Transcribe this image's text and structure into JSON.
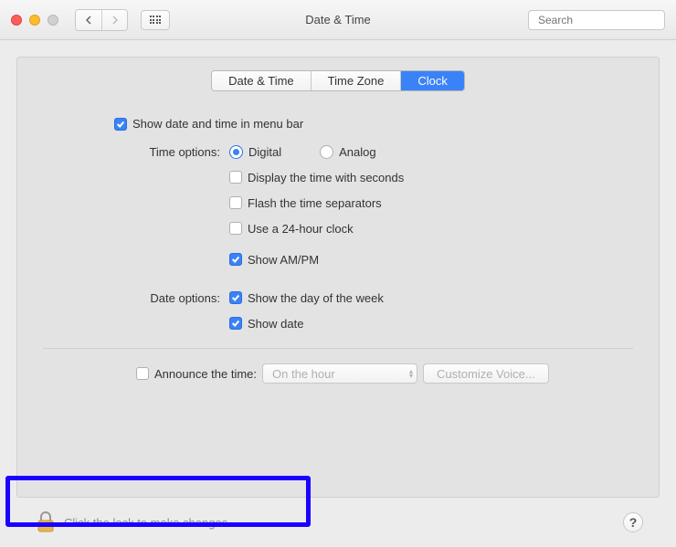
{
  "window": {
    "title": "Date & Time"
  },
  "search": {
    "placeholder": "Search"
  },
  "tabs": {
    "date_time": "Date & Time",
    "time_zone": "Time Zone",
    "clock": "Clock"
  },
  "clock": {
    "show_in_menu_bar": "Show date and time in menu bar",
    "time_options_label": "Time options:",
    "digital": "Digital",
    "analog": "Analog",
    "display_seconds": "Display the time with seconds",
    "flash_separators": "Flash the time separators",
    "use_24h": "Use a 24-hour clock",
    "show_ampm": "Show AM/PM",
    "date_options_label": "Date options:",
    "show_day_of_week": "Show the day of the week",
    "show_date": "Show date",
    "announce_label": "Announce the time:",
    "announce_interval": "On the hour",
    "customize_voice": "Customize Voice..."
  },
  "footer": {
    "lock_message": "Click the lock to make changes.",
    "help": "?"
  }
}
